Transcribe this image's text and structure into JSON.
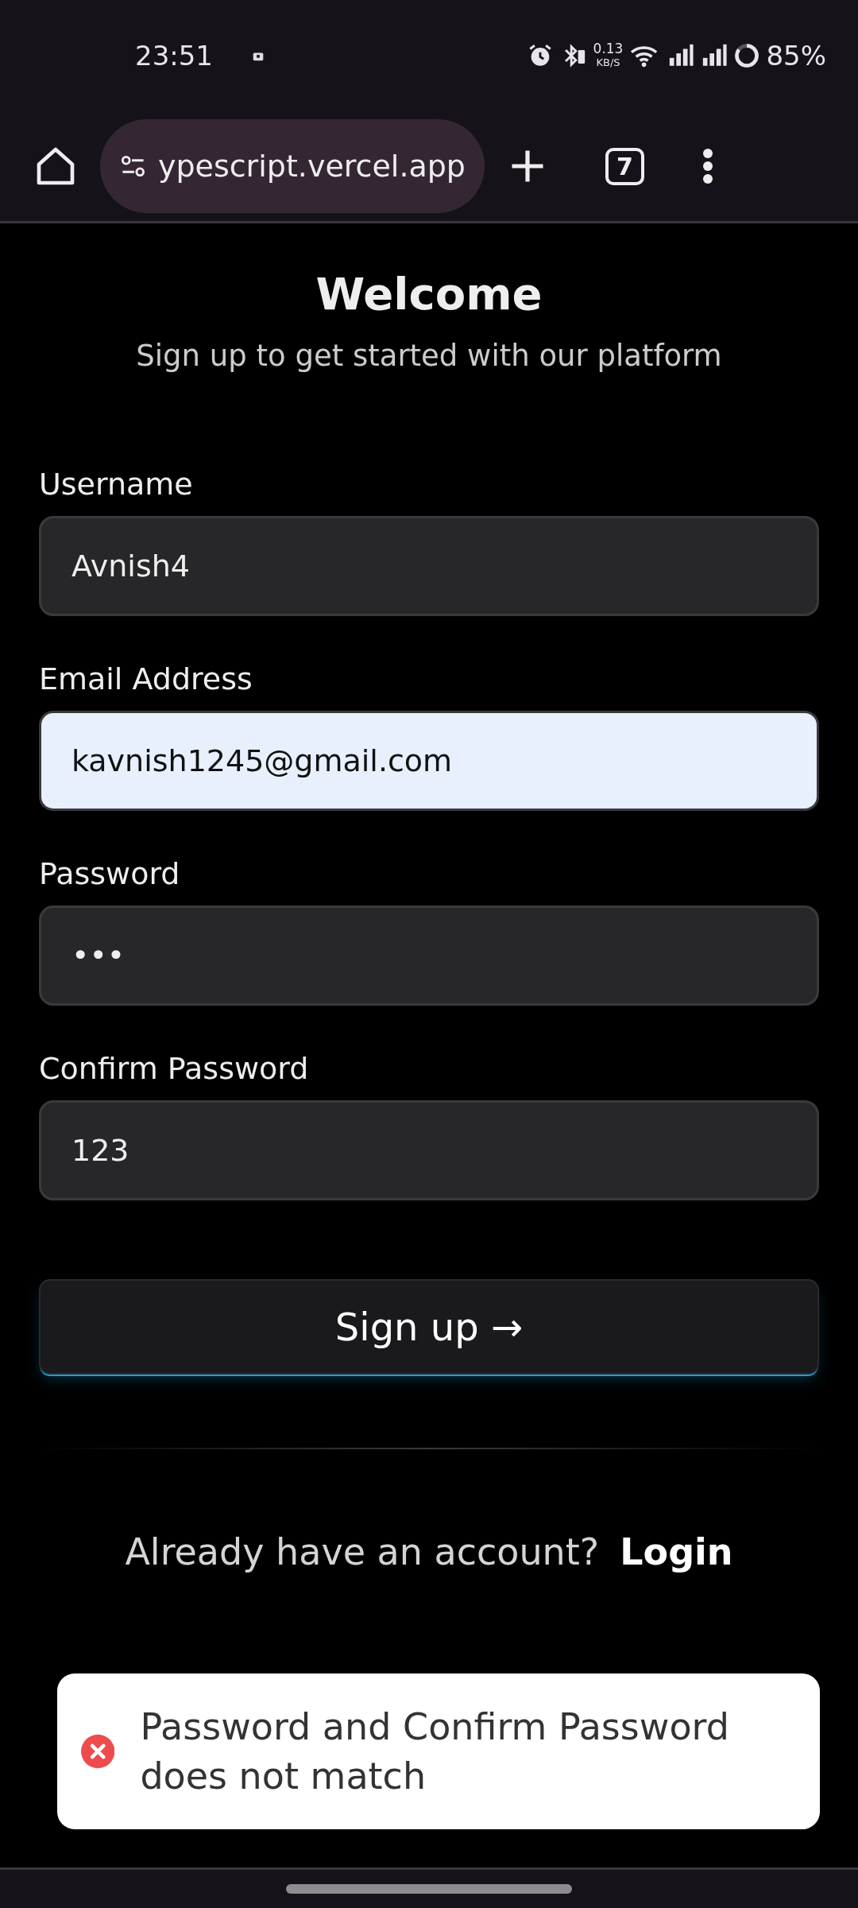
{
  "status_bar": {
    "time": "23:51",
    "net_speed": "0.13",
    "net_unit": "KB/S",
    "battery": "85%"
  },
  "browser": {
    "url": "ypescript.vercel.app",
    "tab_count": "7"
  },
  "form": {
    "title": "Welcome",
    "subtitle": "Sign up to get started with our platform",
    "fields": [
      {
        "label": "Username",
        "value": "Avnish4",
        "autofilled": false
      },
      {
        "label": "Email Address",
        "value": "kavnish1245@gmail.com",
        "autofilled": true
      },
      {
        "label": "Password",
        "value": "•••",
        "autofilled": false
      },
      {
        "label": "Confirm Password",
        "value": "123",
        "autofilled": false
      }
    ],
    "submit": "Sign up →",
    "prompt": "Already have an account?",
    "link": "Login"
  },
  "toast": {
    "kind": "error",
    "message": "Password and Confirm Password does not match"
  }
}
